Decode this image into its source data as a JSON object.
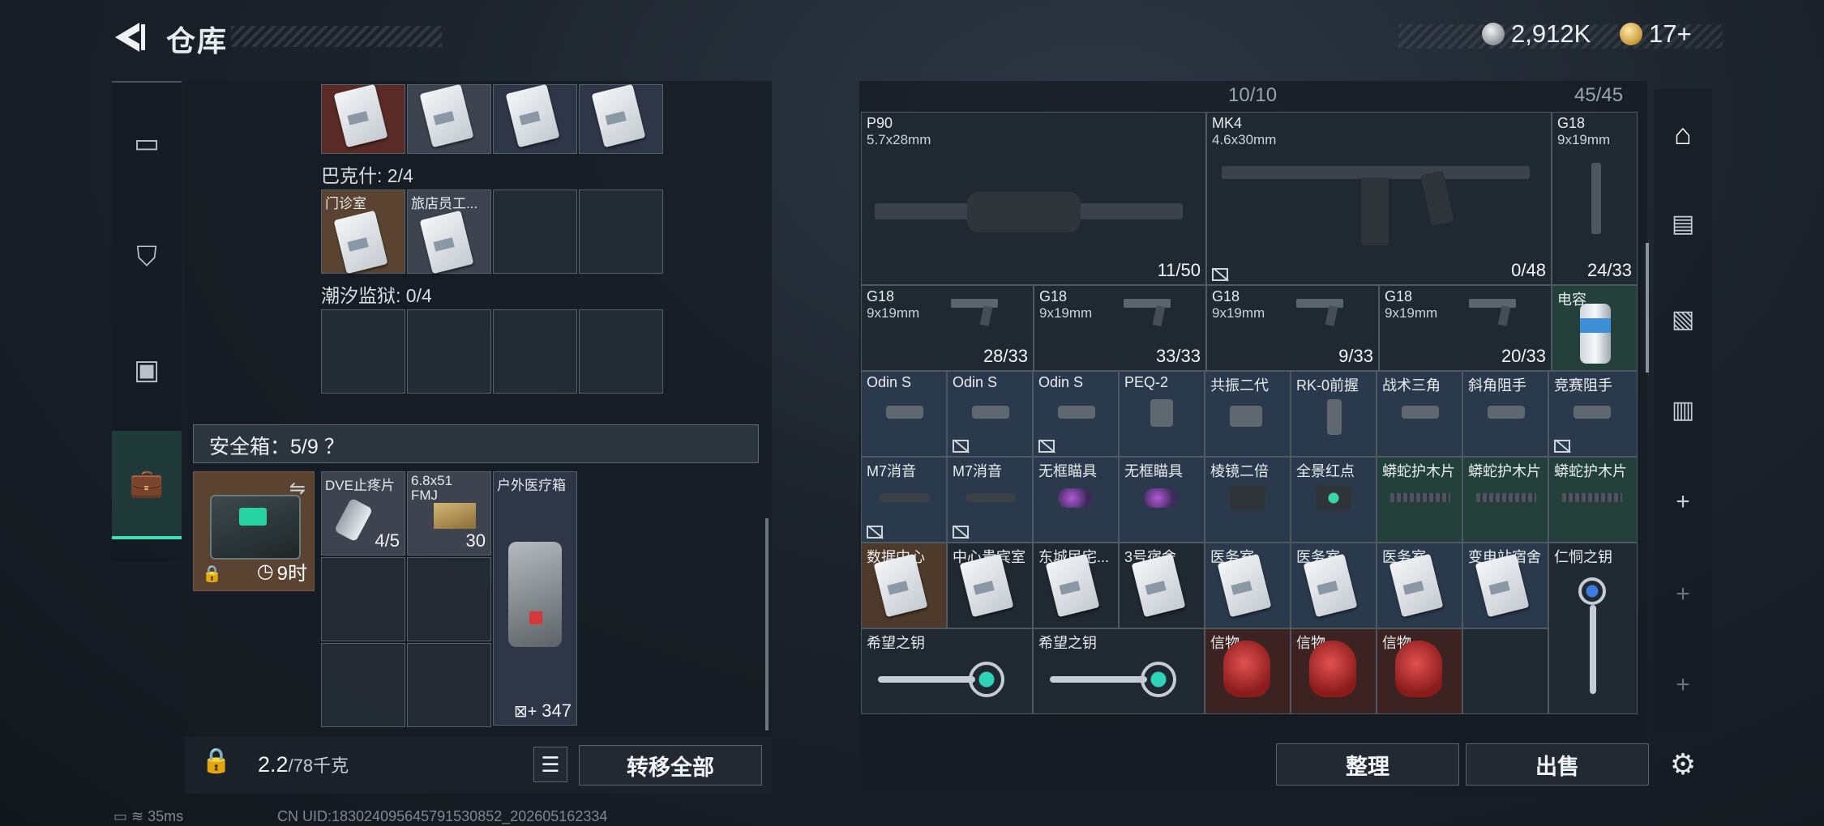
{
  "header": {
    "title": "仓库",
    "currency_1": "2,912K",
    "currency_2": "17+"
  },
  "left": {
    "group_bakeshi": "巴克什: 2/4",
    "bakeshi_items": [
      "门诊室",
      "旅店员工..."
    ],
    "group_chaoxi": "潮汐监狱: 0/4",
    "safebox_title": "安全箱：5/9 ？",
    "safebox_time": "9时",
    "safe_items": [
      {
        "name": "DVE止疼片",
        "count": "4/5"
      },
      {
        "name": "6.8x51 FMJ",
        "count": "30"
      },
      {
        "name": "户外医疗箱",
        "count": "347"
      }
    ],
    "weight_value": "2.2",
    "weight_unit": "/78千克",
    "transfer_all": "转移全部"
  },
  "right": {
    "cap_left": "10/10",
    "cap_right": "45/45",
    "guns": [
      {
        "name": "P90",
        "ammo": "5.7x28mm",
        "count": "11/50"
      },
      {
        "name": "MK4",
        "ammo": "4.6x30mm",
        "count": "0/48"
      },
      {
        "name": "G18",
        "ammo": "9x19mm",
        "count": "24/33"
      }
    ],
    "pistols": [
      {
        "name": "G18",
        "ammo": "9x19mm",
        "count": "28/33"
      },
      {
        "name": "G18",
        "ammo": "9x19mm",
        "count": "33/33"
      },
      {
        "name": "G18",
        "ammo": "9x19mm",
        "count": "9/33"
      },
      {
        "name": "G18",
        "ammo": "9x19mm",
        "count": "20/33"
      }
    ],
    "canister": "电容",
    "row_attach1": [
      "Odin S",
      "Odin S",
      "Odin S",
      "PEQ-2",
      "共振二代",
      "RK-0前握",
      "战术三角",
      "斜角阻手",
      "竞赛阻手"
    ],
    "row_attach2": [
      "M7消音",
      "M7消音",
      "无框瞄具",
      "无框瞄具",
      "棱镜二倍",
      "全景红点",
      "蟒蛇护木片",
      "蟒蛇护木片",
      "蟒蛇护木片"
    ],
    "row_cards": [
      "数据中心",
      "中心贵宾室",
      "东城民宅...",
      "3号宿舍",
      "医务室",
      "医务室",
      "医务室",
      "变电站宿舍"
    ],
    "key_renwu": "仁恫之钥",
    "key_hope": "希望之钥",
    "relic": "信物",
    "organize": "整理",
    "sell": "出售"
  },
  "status": {
    "ping": "35ms",
    "uid": "CN UID:183024095645791530852_202605162334"
  }
}
